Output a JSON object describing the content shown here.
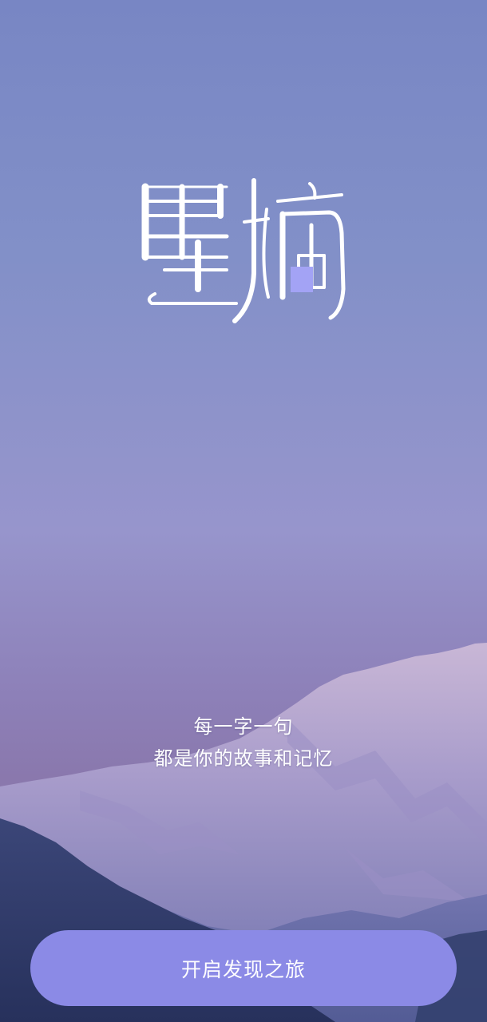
{
  "app": {
    "logo_text": "墨摘"
  },
  "tagline": {
    "line1": "每一字一句",
    "line2": "都是你的故事和记忆"
  },
  "button": {
    "label": "开启发现之旅"
  },
  "colors": {
    "sky_top": "#7886c4",
    "sky_mid": "#9795cc",
    "mountain_dark": "#2f3c6c",
    "button_bg": "#8b8ae6",
    "logo_accent": "#a3a3f5"
  }
}
